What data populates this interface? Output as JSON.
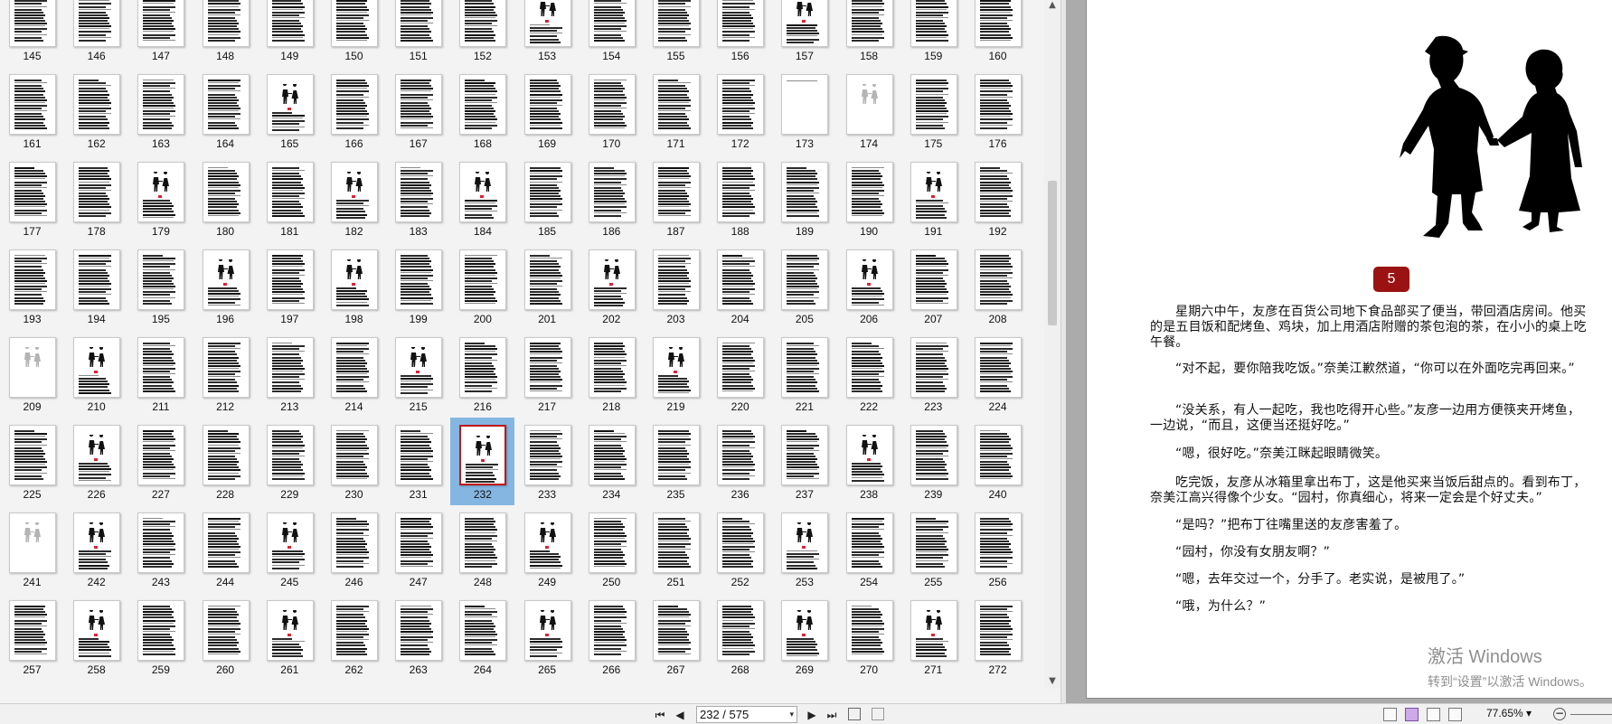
{
  "thumbnails": {
    "rows": [
      {
        "pages": [
          145,
          146,
          147,
          148,
          149,
          150,
          151,
          152,
          153,
          154,
          155,
          156,
          157,
          158,
          159,
          160
        ]
      },
      {
        "pages": [
          161,
          162,
          163,
          164,
          165,
          166,
          167,
          168,
          169,
          170,
          171,
          172,
          173,
          174,
          175,
          176
        ]
      },
      {
        "pages": [
          177,
          178,
          179,
          180,
          181,
          182,
          183,
          184,
          185,
          186,
          187,
          188,
          189,
          190,
          191,
          192
        ]
      },
      {
        "pages": [
          193,
          194,
          195,
          196,
          197,
          198,
          199,
          200,
          201,
          202,
          203,
          204,
          205,
          206,
          207,
          208
        ]
      },
      {
        "pages": [
          209,
          210,
          211,
          212,
          213,
          214,
          215,
          216,
          217,
          218,
          219,
          220,
          221,
          222,
          223,
          224
        ]
      },
      {
        "pages": [
          225,
          226,
          227,
          228,
          229,
          230,
          231,
          232,
          233,
          234,
          235,
          236,
          237,
          238,
          239,
          240
        ]
      },
      {
        "pages": [
          241,
          242,
          243,
          244,
          245,
          246,
          247,
          248,
          249,
          250,
          251,
          252,
          253,
          254,
          255,
          256
        ]
      },
      {
        "pages": [
          257,
          258,
          259,
          260,
          261,
          262,
          263,
          264,
          265,
          266,
          267,
          268,
          269,
          270,
          271,
          272
        ]
      }
    ],
    "selected_page": 232,
    "figure_pages": [
      153,
      157,
      165,
      179,
      182,
      184,
      191,
      196,
      198,
      202,
      206,
      210,
      215,
      219,
      226,
      232,
      238,
      242,
      245,
      249,
      253,
      258,
      261,
      265,
      269,
      271
    ],
    "grey_figure_pages": [
      174,
      209,
      241
    ],
    "blank_pages": [
      173
    ]
  },
  "preview": {
    "chapter_number": "5",
    "paragraphs": [
      "星期六中午，友彦在百货公司地下食品部买了便当，带回酒店房间。他买的是五目饭和配烤鱼、鸡块，加上用酒店附赠的茶包泡的茶，在小小的桌上吃午餐。",
      "“对不起，要你陪我吃饭。”奈美江歉然道，“你可以在外面吃完再回来。”",
      "“没关系，有人一起吃，我也吃得开心些。”友彦一边用方便筷夹开烤鱼，一边说，“而且，这便当还挺好吃。”",
      "“嗯，很好吃。”奈美江眯起眼睛微笑。",
      "吃完饭，友彦从冰箱里拿出布丁，这是他买来当饭后甜点的。看到布丁，奈美江高兴得像个少女。“园村，你真细心，将来一定会是个好丈夫。”",
      "“是吗？”把布丁往嘴里送的友彦害羞了。",
      "“园村，你没有女朋友啊？”",
      "“嗯，去年交过一个，分手了。老实说，是被甩了。”",
      "“哦，为什么？”"
    ]
  },
  "watermark": {
    "title": "激活 Windows",
    "subtitle": "转到“设置”以激活 Windows。"
  },
  "toolbar": {
    "page_indicator": "232 / 575",
    "zoom": "77.65%",
    "zoom_dropdown_glyph": "▾",
    "zoom_minus": "−",
    "dropdown_glyph": "▾",
    "first_glyph": "⏮",
    "prev_glyph": "◀",
    "next_glyph": "▶",
    "last_glyph": "⏭"
  },
  "colors": {
    "selection": "#85b6e2",
    "selected_border": "#c01818",
    "chapter_badge": "#9b1212"
  }
}
